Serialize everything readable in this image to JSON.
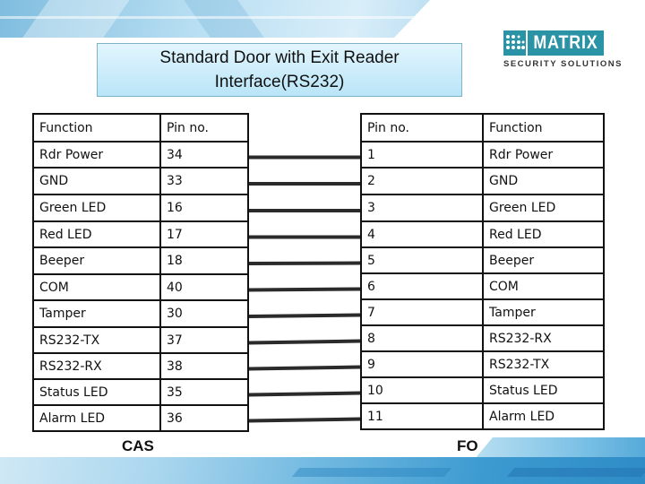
{
  "title": "Standard Door with Exit Reader\nInterface(RS232)",
  "logo": {
    "brand": "MATRIX",
    "tagline": "SECURITY SOLUTIONS",
    "brand_color": "#2a93a5"
  },
  "cas_table": {
    "caption": "CAS",
    "headers": [
      "Function",
      "Pin no."
    ],
    "rows": [
      {
        "function": "Rdr Power",
        "pin": "34"
      },
      {
        "function": "GND",
        "pin": "33"
      },
      {
        "function": "Green LED",
        "pin": "16"
      },
      {
        "function": "Red LED",
        "pin": "17"
      },
      {
        "function": "Beeper",
        "pin": "18"
      },
      {
        "function": "COM",
        "pin": "40"
      },
      {
        "function": "Tamper",
        "pin": "30"
      },
      {
        "function": "RS232-TX",
        "pin": "37"
      },
      {
        "function": "RS232-RX",
        "pin": "38"
      },
      {
        "function": "Status LED",
        "pin": "35"
      },
      {
        "function": "Alarm LED",
        "pin": "36"
      }
    ]
  },
  "fo_table": {
    "caption": "FO",
    "headers": [
      "Pin no.",
      "Function"
    ],
    "rows": [
      {
        "pin": "1",
        "function": "Rdr Power"
      },
      {
        "pin": "2",
        "function": "GND"
      },
      {
        "pin": "3",
        "function": "Green LED"
      },
      {
        "pin": "4",
        "function": "Red LED"
      },
      {
        "pin": "5",
        "function": "Beeper"
      },
      {
        "pin": "6",
        "function": "COM"
      },
      {
        "pin": "7",
        "function": "Tamper"
      },
      {
        "pin": "8",
        "function": "RS232-RX"
      },
      {
        "pin": "9",
        "function": "RS232-TX"
      },
      {
        "pin": "10",
        "function": "Status LED"
      },
      {
        "pin": "11",
        "function": "Alarm LED"
      }
    ]
  },
  "connections": [
    {
      "from_pin": "34",
      "to_pin": "1"
    },
    {
      "from_pin": "33",
      "to_pin": "2"
    },
    {
      "from_pin": "16",
      "to_pin": "3"
    },
    {
      "from_pin": "17",
      "to_pin": "4"
    },
    {
      "from_pin": "18",
      "to_pin": "5"
    },
    {
      "from_pin": "40",
      "to_pin": "6"
    },
    {
      "from_pin": "30",
      "to_pin": "7"
    },
    {
      "from_pin": "37",
      "to_pin": "8"
    },
    {
      "from_pin": "38",
      "to_pin": "9"
    },
    {
      "from_pin": "35",
      "to_pin": "10"
    },
    {
      "from_pin": "36",
      "to_pin": "11"
    }
  ]
}
